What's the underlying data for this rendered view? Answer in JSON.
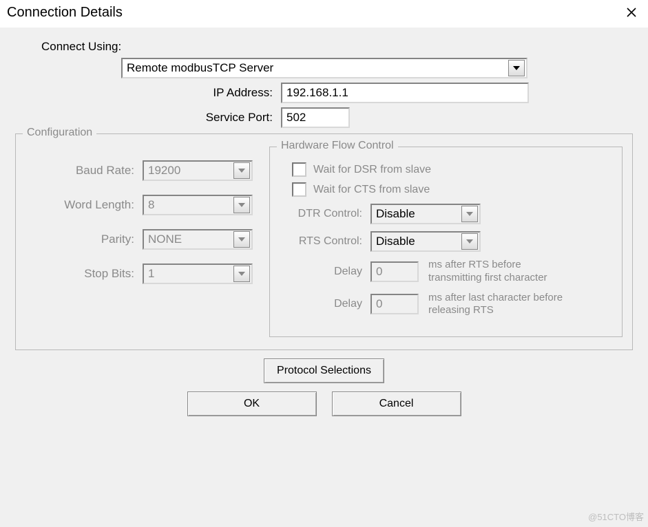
{
  "title": "Connection Details",
  "connect_using": {
    "label": "Connect Using:",
    "value": "Remote modbusTCP Server"
  },
  "ip": {
    "label": "IP Address:",
    "value": "192.168.1.1"
  },
  "port": {
    "label": "Service Port:",
    "value": "502"
  },
  "config": {
    "legend": "Configuration",
    "baud": {
      "label": "Baud Rate:",
      "value": "19200"
    },
    "wordlen": {
      "label": "Word Length:",
      "value": "8"
    },
    "parity": {
      "label": "Parity:",
      "value": "NONE"
    },
    "stop": {
      "label": "Stop Bits:",
      "value": "1"
    }
  },
  "hw": {
    "legend": "Hardware Flow Control",
    "wait_dsr": "Wait for DSR from slave",
    "wait_cts": "Wait for CTS from slave",
    "dtr": {
      "label": "DTR Control:",
      "value": "Disable"
    },
    "rts": {
      "label": "RTS Control:",
      "value": "Disable"
    },
    "delay_label": "Delay",
    "delay1": {
      "value": "0",
      "note": "ms after RTS before transmitting first character"
    },
    "delay2": {
      "value": "0",
      "note": "ms after last character before releasing RTS"
    }
  },
  "buttons": {
    "protocol": "Protocol Selections",
    "ok": "OK",
    "cancel": "Cancel"
  },
  "watermark": "@51CTO博客"
}
